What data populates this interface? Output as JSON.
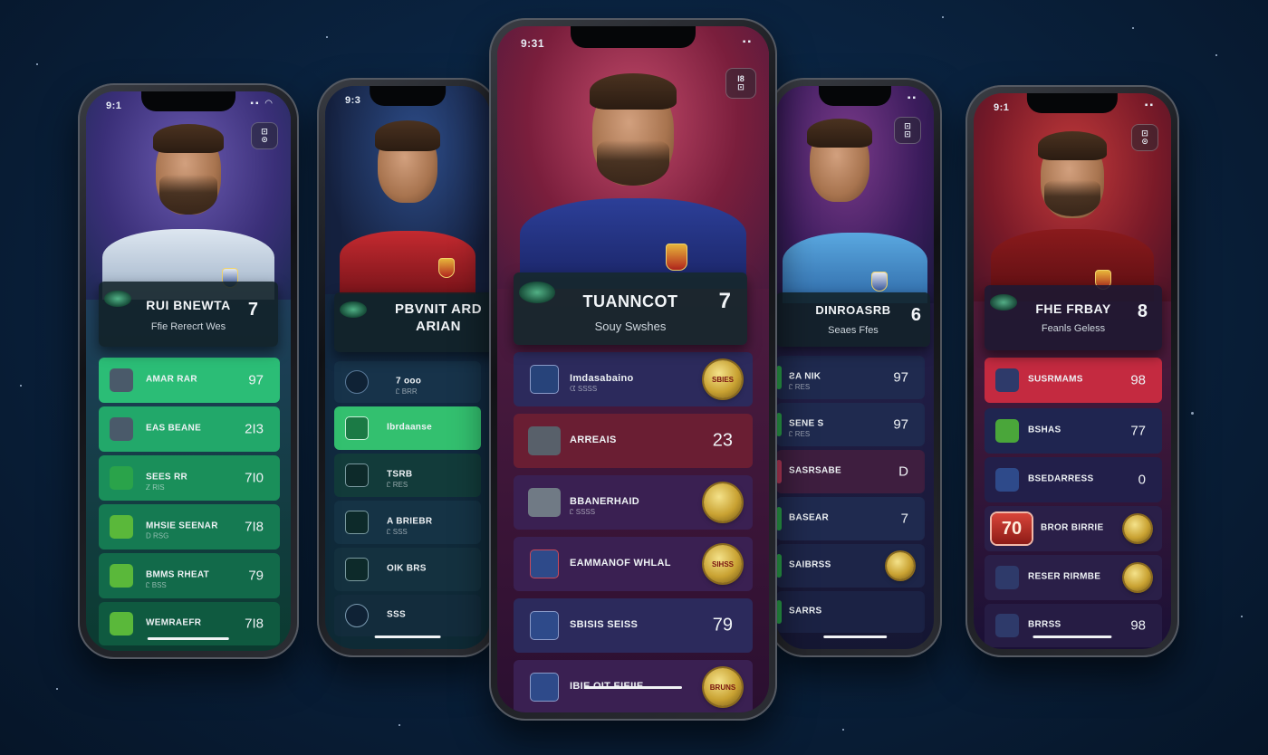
{
  "phones": [
    {
      "id": "p1",
      "theme": {
        "bg_top": "#3a2f78",
        "bg_bottom": "#0b3b30",
        "row": "#1f8f5c",
        "row_active": "#2bbd76",
        "jersey": "#cfdbe8",
        "accent": "#2bbd76"
      },
      "status": {
        "time": "9:1",
        "icons": "▪▪ ◠"
      },
      "badge": "⊡\n⊙",
      "card": {
        "name": "RUI BNEWTA",
        "sub": "Ffie Rerecrt Wes",
        "number": "7"
      },
      "rows": [
        {
          "label": "AMAR RAR",
          "sub": "",
          "value": "97",
          "icon_color": "#556070"
        },
        {
          "label": "EAS BEANE",
          "sub": "",
          "value": "2I3",
          "icon_color": "#556070"
        },
        {
          "label": "SEES RR",
          "sub": "Ꮓ RIS",
          "value": "7I0",
          "icon_color": "#2aa34a"
        },
        {
          "label": "MHSIE SEENAR",
          "sub": "D RSG",
          "value": "7I8",
          "icon_color": "#5ab83a"
        },
        {
          "label": "BMMS RHEAT",
          "sub": "Ꮭ BSS",
          "value": "79",
          "icon_color": "#5ab83a"
        },
        {
          "label": "WEMRAEFR",
          "sub": "",
          "value": "7I8",
          "icon_color": "#5ab83a"
        }
      ]
    },
    {
      "id": "p2",
      "theme": {
        "bg_top": "#17203f",
        "bg_bottom": "#0e2a35",
        "row": "#123b3a",
        "row_active": "#33c06f",
        "jersey": "#b1212a",
        "accent": "#33c06f"
      },
      "status": {
        "time": "9:3",
        "icons": ""
      },
      "badge": "",
      "card": {
        "name": "PBVNIT ARD\nARIAN",
        "sub": "",
        "number": ""
      },
      "rows": [
        {
          "label": "7 ooo",
          "sub": "Ꮭ BRR",
          "value": "",
          "icon_color": "#1c3550"
        },
        {
          "label": "Ibrdaanse",
          "sub": "",
          "value": "",
          "icon_color": "#2ea35c"
        },
        {
          "label": "TSRB",
          "sub": "Ꮭ RES",
          "value": "",
          "icon_color": "#1c3550"
        },
        {
          "label": "A BRIEBR",
          "sub": "Ꮭ SSS",
          "value": "",
          "icon_color": "#1c3550"
        },
        {
          "label": "OIK BRS",
          "sub": "",
          "value": "",
          "icon_color": "#1c3550"
        },
        {
          "label": "SSS",
          "sub": "",
          "value": "",
          "icon_color": "#1c3550"
        }
      ]
    },
    {
      "id": "p3",
      "theme": {
        "bg_top": "#7a1e3c",
        "bg_bottom": "#2a0f30",
        "row": "#2c2a5c",
        "row_active": "#6a1e33",
        "jersey": "#26358a",
        "accent": "#e4b53e"
      },
      "status": {
        "time": "9:31",
        "icons": "▪▪"
      },
      "badge": "I8\n⊡",
      "card": {
        "name": "TUANNCOT",
        "sub": "Souy Swshes",
        "number": "7"
      },
      "rows": [
        {
          "label": "Imdasabaino",
          "sub": "ᗧ SSSS",
          "value": "",
          "coin": "SBIES",
          "icon_color": "#27437a"
        },
        {
          "label": "ARREAIS",
          "sub": "",
          "value": "23",
          "coin": "",
          "icon_color": "#58606a"
        },
        {
          "label": "BBANERHAID",
          "sub": "Ꮭ SSSS",
          "value": "",
          "coin": "",
          "icon_color": "#707a85"
        },
        {
          "label": "EAMMANOF WHLAL",
          "sub": "",
          "value": "",
          "coin": "SIHSS",
          "icon_color": "#2e4a8a"
        },
        {
          "label": "SBISIS SEISS",
          "sub": "",
          "value": "79",
          "coin": "",
          "icon_color": "#2e4a8a"
        },
        {
          "label": "IBIE OIT EIEIIE",
          "sub": "",
          "value": "",
          "coin": "BRUNS",
          "icon_color": "#2e4a8a"
        }
      ]
    },
    {
      "id": "p4",
      "theme": {
        "bg_top": "#3b1c5c",
        "bg_bottom": "#151733",
        "row": "#1f2a4f",
        "row_active": "#3e1e3f",
        "jersey": "#4e9ed8",
        "accent": "#e4b53e"
      },
      "status": {
        "time": "",
        "icons": "▪▪"
      },
      "badge": "⊡\n⊡",
      "card": {
        "name": "DINROASRB",
        "sub": "Seaes Ffes",
        "number": "6"
      },
      "rows": [
        {
          "label": "ƧA NIK",
          "sub": "Ꮭ RES",
          "value": "97",
          "icon_color": "#2aa34a"
        },
        {
          "label": "SENE S",
          "sub": "Ꮭ RES",
          "value": "97",
          "icon_color": "#2aa34a"
        },
        {
          "label": "SASRSABE",
          "sub": "",
          "value": "D",
          "icon_color": "#b83a5a"
        },
        {
          "label": "BASEAR",
          "sub": "",
          "value": "7",
          "icon_color": "#2aa34a"
        },
        {
          "label": "SAIBRSS",
          "sub": "",
          "value": "",
          "icon_color": "#2aa34a"
        },
        {
          "label": "SARRS",
          "sub": "",
          "value": "",
          "icon_color": "#2aa34a"
        }
      ]
    },
    {
      "id": "p5",
      "theme": {
        "bg_top": "#7a1a28",
        "bg_bottom": "#1a1036",
        "row": "#1f2550",
        "row_active": "#c42a40",
        "jersey": "#7a1517",
        "accent": "#e4b53e"
      },
      "status": {
        "time": "9:1",
        "icons": "▪▪"
      },
      "badge": "⊡\n⊙",
      "card": {
        "name": "FHE FRBAY",
        "sub": "Feanls Geless",
        "number": "8"
      },
      "rows": [
        {
          "label": "SUSRMAMS",
          "sub": "",
          "value": "98",
          "icon_color": "#2e3a6a"
        },
        {
          "label": "BSHAS",
          "sub": "",
          "value": "77",
          "icon_color": "#4aa63a"
        },
        {
          "label": "BSEDARRESS",
          "sub": "",
          "value": "0",
          "icon_color": "#2e4a8a"
        },
        {
          "label": "BROR BIRRIE",
          "sub": "",
          "value": "",
          "badge": "70",
          "icon_color": ""
        },
        {
          "label": "RESER RIRMBE",
          "sub": "",
          "value": "",
          "icon_color": "#2e3a6a"
        },
        {
          "label": "BRRSS",
          "sub": "",
          "value": "98",
          "icon_color": "#2e3a6a"
        }
      ]
    }
  ]
}
